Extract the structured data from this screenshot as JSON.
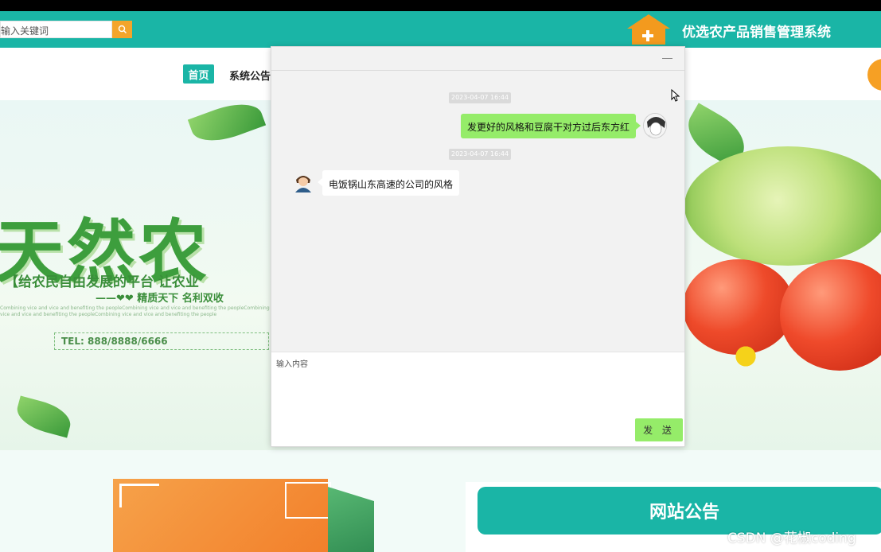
{
  "header": {
    "search_placeholder": "输入关键词",
    "site_title": "优选农产品销售管理系统"
  },
  "nav": {
    "home": "首页",
    "notice": "系统公告"
  },
  "banner": {
    "title": "天然农",
    "slogan": "【给农民自由发展的平台  让农业",
    "slogan2": "——❤❤ 精质天下  名利双收",
    "fine_print": "Combining vice and vice and benefiting the peopleCombining vice and vice and benefiting the peopleCombining vice and vice and benefiting the peopleCombining vice and vice and benefiting the people",
    "tel": "TEL: 888/8888/6666"
  },
  "chat": {
    "messages": [
      {
        "time": "2023-04-07 16:44",
        "side": "right",
        "text": "发更好的风格和豆腐干对方过后东方红"
      },
      {
        "time": "2023-04-07 16:44",
        "side": "left",
        "text": "电饭锅山东高速的公司的风格"
      }
    ],
    "input_placeholder": "输入内容",
    "send_label": "发 送"
  },
  "lower": {
    "notice_title": "网站公告",
    "watermark": "CSDN @花椒coding"
  },
  "colors": {
    "brand": "#1ab5a6",
    "accent": "#f3a52b",
    "bubble": "#95ec69"
  }
}
